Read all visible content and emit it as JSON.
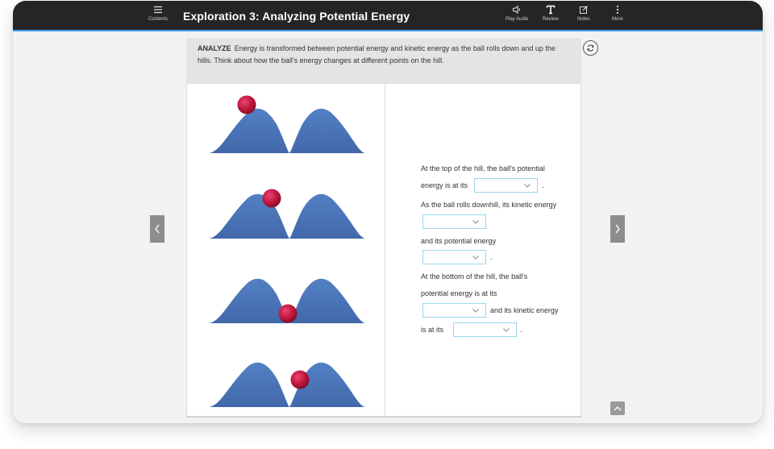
{
  "header": {
    "title": "Exploration 3: Analyzing Potential Energy",
    "contents_label": "Contents",
    "play_audio_label": "Play Audio",
    "review_label": "Review",
    "notes_label": "Notes",
    "more_label": "More"
  },
  "analyze": {
    "tag": "ANALYZE",
    "text": "Energy is transformed between potential energy and kinetic energy as the ball rolls down and up the hills. Think about how the ball's energy changes at different points on the hill."
  },
  "questions": {
    "q1_line1": "At the top of the hill, the ball's potential",
    "q1_line2": "energy is at its",
    "q2_line1": "As the ball rolls downhill, its kinetic energy",
    "q3_line1": "and its potential energy",
    "q4_line1": "At the bottom of the hill, the ball's",
    "q4_line2": "potential energy is at its",
    "q4_after": "and its kinetic energy",
    "q5_line1": "is at its",
    "period": "."
  },
  "dropdowns": {
    "top_potential": "",
    "downhill_kinetic": "",
    "downhill_potential": "",
    "bottom_potential": "",
    "bottom_kinetic": ""
  },
  "icons": {
    "contents": "hamburger-icon",
    "audio": "speaker-icon",
    "review": "text-t-icon",
    "notes": "edit-note-icon",
    "more": "vertical-dots-icon",
    "refresh": "refresh-icon",
    "prev": "chevron-left-icon",
    "next": "chevron-right-icon",
    "up": "chevron-up-icon"
  },
  "colors": {
    "topbar": "#252525",
    "accent": "#3d9be9",
    "hill": "#4a72b6",
    "ball": "#c3173e",
    "dropdown_border": "#9ad6f0"
  }
}
